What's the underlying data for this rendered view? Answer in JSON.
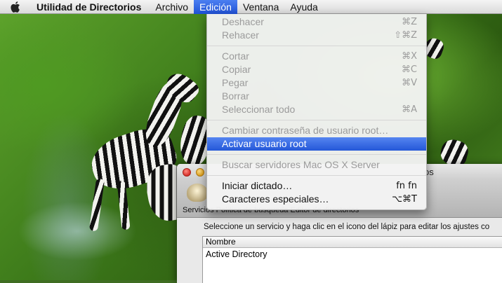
{
  "menubar": {
    "app_name": "Utilidad de Directorios",
    "items": [
      "Archivo",
      "Edición",
      "Ventana",
      "Ayuda"
    ],
    "active_item": "Edición"
  },
  "edit_menu": {
    "groups": [
      [
        {
          "label": "Deshacer",
          "shortcut": "⌘Z",
          "enabled": false
        },
        {
          "label": "Rehacer",
          "shortcut": "⇧⌘Z",
          "enabled": false
        }
      ],
      [
        {
          "label": "Cortar",
          "shortcut": "⌘X",
          "enabled": false
        },
        {
          "label": "Copiar",
          "shortcut": "⌘C",
          "enabled": false
        },
        {
          "label": "Pegar",
          "shortcut": "⌘V",
          "enabled": false
        },
        {
          "label": "Borrar",
          "shortcut": "",
          "enabled": false
        },
        {
          "label": "Seleccionar todo",
          "shortcut": "⌘A",
          "enabled": false
        }
      ],
      [
        {
          "label": "Cambiar contraseña de usuario root…",
          "shortcut": "",
          "enabled": false
        },
        {
          "label": "Activar usuario root",
          "shortcut": "",
          "enabled": true,
          "highlighted": true
        }
      ],
      [
        {
          "label": "Buscar servidores Mac OS X Server",
          "shortcut": "",
          "enabled": false
        }
      ],
      [
        {
          "label": "Iniciar dictado…",
          "shortcut": "fn fn",
          "enabled": true
        },
        {
          "label": "Caracteres especiales…",
          "shortcut": "⌥⌘T",
          "enabled": true
        }
      ]
    ]
  },
  "window": {
    "title_tail": "os",
    "toolbar_labels": "Servicios    Política de búsqueda    Editor de directorios",
    "instructions": "Seleccione un servicio y haga clic en el icono del lápiz para editar los ajustes co",
    "table": {
      "header": "Nombre",
      "rows": [
        "Active Directory"
      ]
    }
  },
  "colors": {
    "menu_highlight": "#2457d8",
    "disabled_text": "#9b9b9b"
  }
}
